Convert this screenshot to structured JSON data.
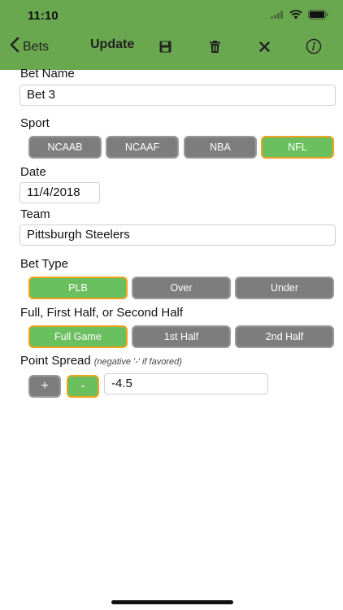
{
  "status": {
    "time": "11:10"
  },
  "nav": {
    "back_label": "Bets",
    "title": "Update",
    "icons": [
      "chevron-left-icon",
      "save-icon",
      "trash-icon",
      "close-icon",
      "info-icon"
    ]
  },
  "form": {
    "bet_name": {
      "label": "Bet Name",
      "value": "Bet 3"
    },
    "sport": {
      "label": "Sport",
      "options": [
        "NCAAB",
        "NCAAF",
        "NBA",
        "NFL"
      ],
      "selected": "NFL"
    },
    "date": {
      "label": "Date",
      "value": "11/4/2018"
    },
    "team": {
      "label": "Team",
      "value": "Pittsburgh Steelers"
    },
    "bet_type": {
      "label": "Bet Type",
      "options": [
        "PLB",
        "Over",
        "Under"
      ],
      "selected": "PLB"
    },
    "period": {
      "label": "Full, First Half, or Second Half",
      "options": [
        "Full Game",
        "1st Half",
        "2nd Half"
      ],
      "selected": "Full Game"
    },
    "point_spread": {
      "label": "Point Spread",
      "hint": "(negative '-' if favored)",
      "plus_label": "+",
      "minus_label": "-",
      "sign_selected": "-",
      "value": "-4.5"
    }
  },
  "colors": {
    "header": "#6aa84f",
    "segment_default": "#7d7d7d",
    "segment_active": "#6abf5e",
    "segment_active_border": "#f0a21c"
  }
}
